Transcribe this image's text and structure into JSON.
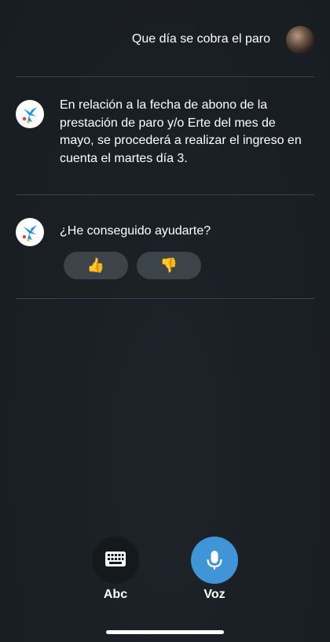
{
  "chat": {
    "user_message": "Que día se cobra el paro",
    "bot_answer": "En relación a la fecha de abono de la prestación de paro y/o Erte del mes de mayo, se procederá a realizar el ingreso en cuenta el martes día 3.",
    "bot_question": "¿He conseguido ayudarte?"
  },
  "feedback": {
    "thumbs_up": "👍",
    "thumbs_down": "👎"
  },
  "input_modes": {
    "keyboard_label": "Abc",
    "voice_label": "Voz"
  },
  "colors": {
    "background": "#1b2025",
    "divider": "#3b4248",
    "feedback_button": "#3c4449",
    "voice_accent": "#3f95d6",
    "keyboard_button": "#14191c",
    "brand_blue": "#1f8fd9"
  },
  "icons": {
    "bot_avatar": "caixabank-star-logo",
    "keyboard": "keyboard-icon",
    "voice": "microphone-icon"
  }
}
